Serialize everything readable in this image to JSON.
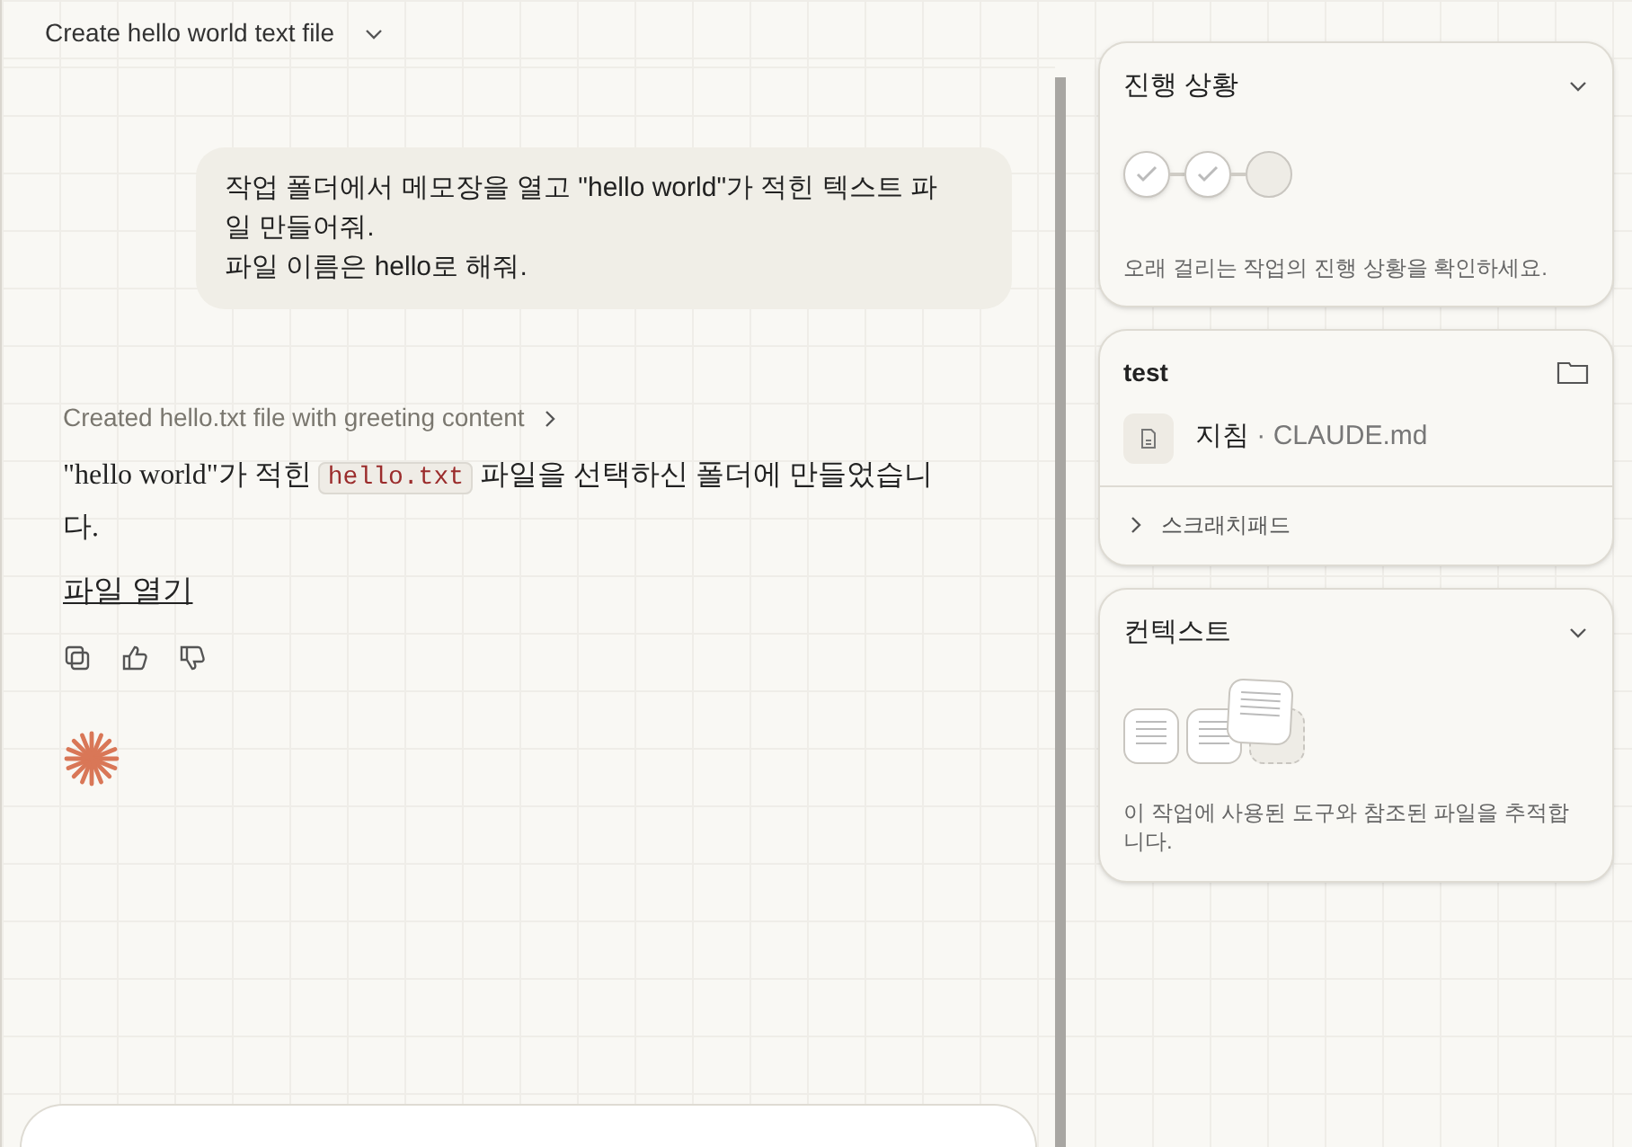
{
  "title": "Create hello world text file",
  "user_message": [
    "작업 폴더에서 메모장을 열고 \"hello world\"가 적힌 텍스트 파일 만들어줘.",
    "파일 이름은 hello로 해줘."
  ],
  "step_summary": "Created hello.txt file with greeting content",
  "reply": {
    "before": "\"hello world\"가 적힌 ",
    "code": "hello.txt",
    "after": " 파일을 선택하신 폴더에 만들었습니다."
  },
  "link": "파일 열기",
  "progress": {
    "title": "진행 상황",
    "expanded": true,
    "steps": [
      {
        "done": true
      },
      {
        "done": true
      },
      {
        "done": false
      }
    ],
    "hint": "오래 걸리는 작업의 진행 상황을 확인하세요."
  },
  "project": {
    "title": "test",
    "file_label": "지침",
    "separator": "·",
    "file_name": "CLAUDE.md",
    "scratchpad": "스크래치패드",
    "scratchpad_expanded": false
  },
  "context": {
    "title": "컨텍스트",
    "expanded": true,
    "hint": "이 작업에 사용된 도구와 참조된 파일을 추적합니다."
  }
}
